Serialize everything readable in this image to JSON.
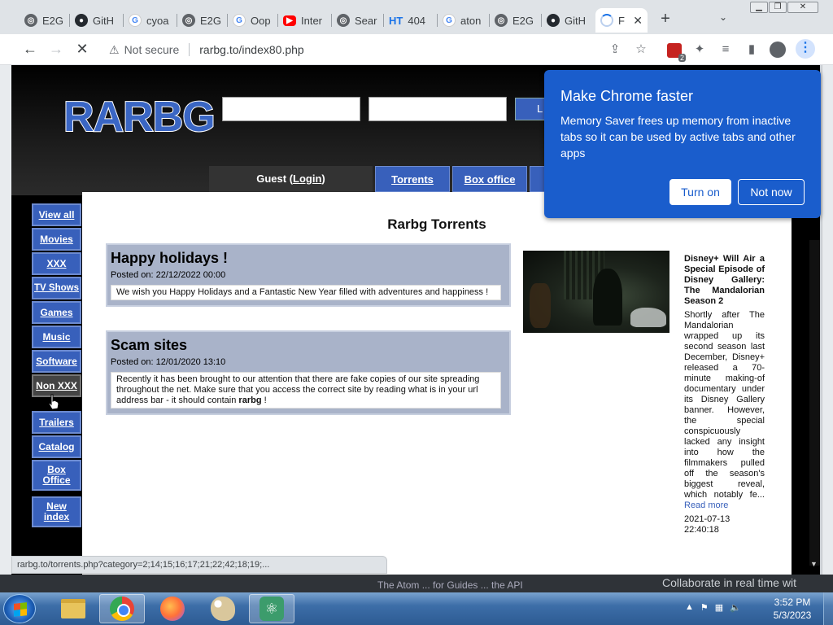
{
  "browser": {
    "tabs": [
      {
        "title": "E2G",
        "icon": "globe-icon"
      },
      {
        "title": "GitH",
        "icon": "github-icon"
      },
      {
        "title": "cyoa",
        "icon": "google-icon"
      },
      {
        "title": "E2G",
        "icon": "globe-icon"
      },
      {
        "title": "Oop",
        "icon": "google-icon"
      },
      {
        "title": "Inter",
        "icon": "youtube-icon"
      },
      {
        "title": "Sear",
        "icon": "globe-icon"
      },
      {
        "title": "404",
        "icon": "ht-icon",
        "icon_text": "HT"
      },
      {
        "title": "aton",
        "icon": "google-icon"
      },
      {
        "title": "E2G",
        "icon": "globe-icon"
      },
      {
        "title": "GitH",
        "icon": "github-icon"
      },
      {
        "title": "F",
        "icon": "loading-spinner-icon",
        "active": true
      }
    ],
    "new_tab": "+",
    "close_glyph": "✕",
    "address": {
      "security": "Not secure",
      "url": "rarbg.to/index80.php"
    },
    "extension_badge": "2",
    "status_url": "rarbg.to/torrents.php?category=2;14;15;16;17;21;22;42;18;19;..."
  },
  "page": {
    "logo": "RARBG",
    "search_button": "L",
    "guest": {
      "prefix": "Guest (",
      "link": "Login",
      "suffix": ")"
    },
    "top_nav": [
      "Torrents",
      "Box office"
    ],
    "sidebar": [
      "View all",
      "Movies",
      "XXX",
      "TV Shows",
      "Games",
      "Music",
      "Software",
      "Non XXX",
      "Trailers",
      "Catalog",
      "Box Office",
      "New index"
    ],
    "title": "Rarbg Torrents",
    "news": [
      {
        "heading": "Happy holidays !",
        "posted": "Posted on: 22/12/2022 00:00",
        "body": "We wish you Happy Holidays and a Fantastic New Year filled with adventures and happiness !"
      },
      {
        "heading": "Scam sites",
        "posted": "Posted on: 12/01/2020 13:10",
        "body": "Recently it has been brought to our attention that there are fake copies of our site spreading throughout the net. Make sure that you access the correct site by reading what is in your url address bar - it should contain ",
        "body_bold": "rarbg",
        "body_end": " !"
      }
    ],
    "article": {
      "title": "Disney+ Will Air a Special Episode of Disney Gallery: The Mandalorian Season 2",
      "text": "Shortly after The Mandalorian wrapped up its second season last December, Disney+ released a 70-minute making-of documentary under its Disney Gallery banner. However, the special conspicuously lacked any insight into how the filmmakers pulled off the season's biggest reveal, which notably fe...",
      "read_more": "Read more",
      "date": "2021-07-13",
      "time": "22:40:18"
    }
  },
  "popup": {
    "title": "Make Chrome faster",
    "body": "Memory Saver frees up memory from inactive tabs so it can be used by active tabs and other apps",
    "turn_on": "Turn on",
    "not_now": "Not now"
  },
  "desktop": {
    "behind_left": "The Atom ... for Guides ... the API",
    "behind_right": "Collaborate in real time wit"
  },
  "taskbar": {
    "time": "3:52 PM",
    "date": "5/3/2023"
  },
  "colors": {
    "rarbg_blue": "#3860bb",
    "chrome_popup": "#1a5dcc",
    "news_panel": "#a9b3c9"
  }
}
